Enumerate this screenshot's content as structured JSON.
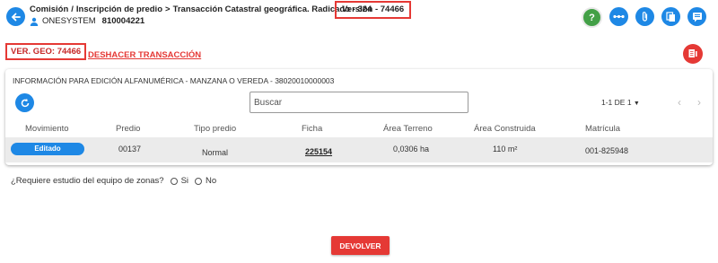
{
  "header": {
    "breadcrumb": [
      "Comisión",
      "Inscripción de predio",
      "Transacción Catastral geográfica. Radicado - 324"
    ],
    "version_label": "Versión - 74466",
    "user_name": "ONESYSTEM",
    "user_id": "810004221",
    "icons": [
      "back-arrow-icon",
      "person-icon",
      "help-icon",
      "dots-icon",
      "paperclip-icon",
      "copy-icon",
      "chat-icon"
    ]
  },
  "subheader": {
    "ver_geo": "VER. GEO: 74466",
    "undo_link": "DESHACER TRANSACCIÓN"
  },
  "panel": {
    "title": "INFORMACIÓN PARA EDICIÓN ALFANUMÉRICA - MANZANA O VEREDA - 38020010000003",
    "search_placeholder": "Buscar",
    "pagination": "1-1 DE 1",
    "columns": [
      "Movimiento",
      "Predio",
      "Tipo predio",
      "Ficha",
      "Área Terreno",
      "Área Construida",
      "Matrícula"
    ],
    "rows": [
      {
        "movimiento": "Editado",
        "predio": "00137",
        "tipo_predio": "Normal",
        "ficha": "225154",
        "area_terreno": "0,0306 ha",
        "area_construida": "110 m²",
        "matricula": "001-825948"
      }
    ]
  },
  "zone_question": {
    "label": "¿Requiere estudio del equipo de zonas?",
    "options": [
      "Si",
      "No"
    ]
  },
  "actions": {
    "return_button": "DEVOLVER"
  },
  "colors": {
    "primary_blue": "#1e88e5",
    "danger_red": "#e53935",
    "help_green": "#43a047"
  }
}
